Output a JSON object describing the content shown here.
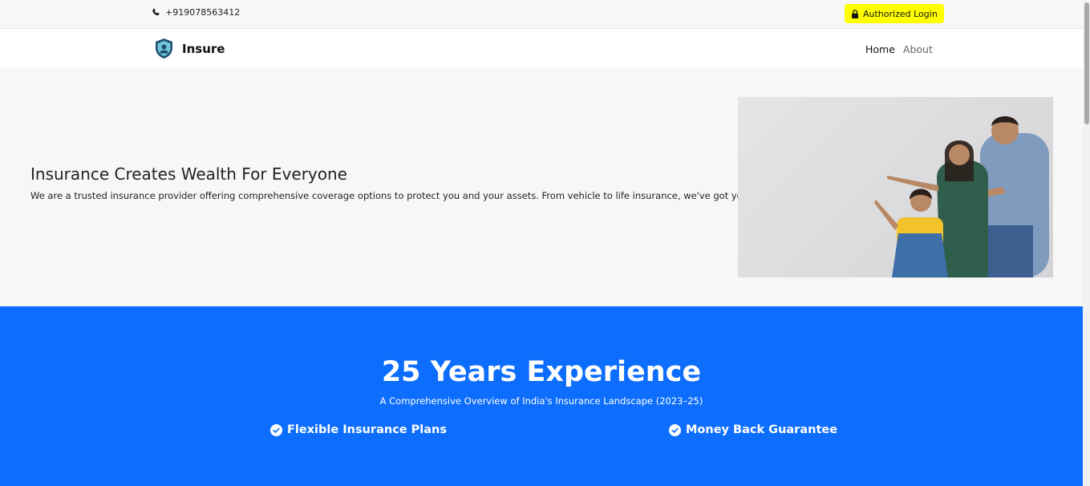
{
  "topbar": {
    "phone": "+919078563412",
    "phone_icon": "phone-icon",
    "login_label": "Authorized Login",
    "login_icon": "lock-icon"
  },
  "navbar": {
    "brand": "Insure",
    "logo_icon": "shield-user-icon",
    "links": [
      {
        "label": "Home"
      },
      {
        "label": "About"
      }
    ]
  },
  "hero": {
    "title": "Insurance Creates Wealth For Everyone",
    "description": "We are a trusted insurance provider offering comprehensive coverage options to protect you and your assets. From vehicle to life insurance, we've got you covered."
  },
  "experience": {
    "title": "25 Years Experience",
    "subtitle": "A Comprehensive Overview of India's Insurance Landscape (2023–25)",
    "features": [
      {
        "label": "Flexible Insurance Plans",
        "icon": "check-circle-icon"
      },
      {
        "label": "Money Back Guarantee",
        "icon": "check-circle-icon"
      }
    ]
  },
  "colors": {
    "accent_blue": "#0d6efd",
    "login_yellow": "#ffff00",
    "hero_bg": "#f7f7f8"
  }
}
